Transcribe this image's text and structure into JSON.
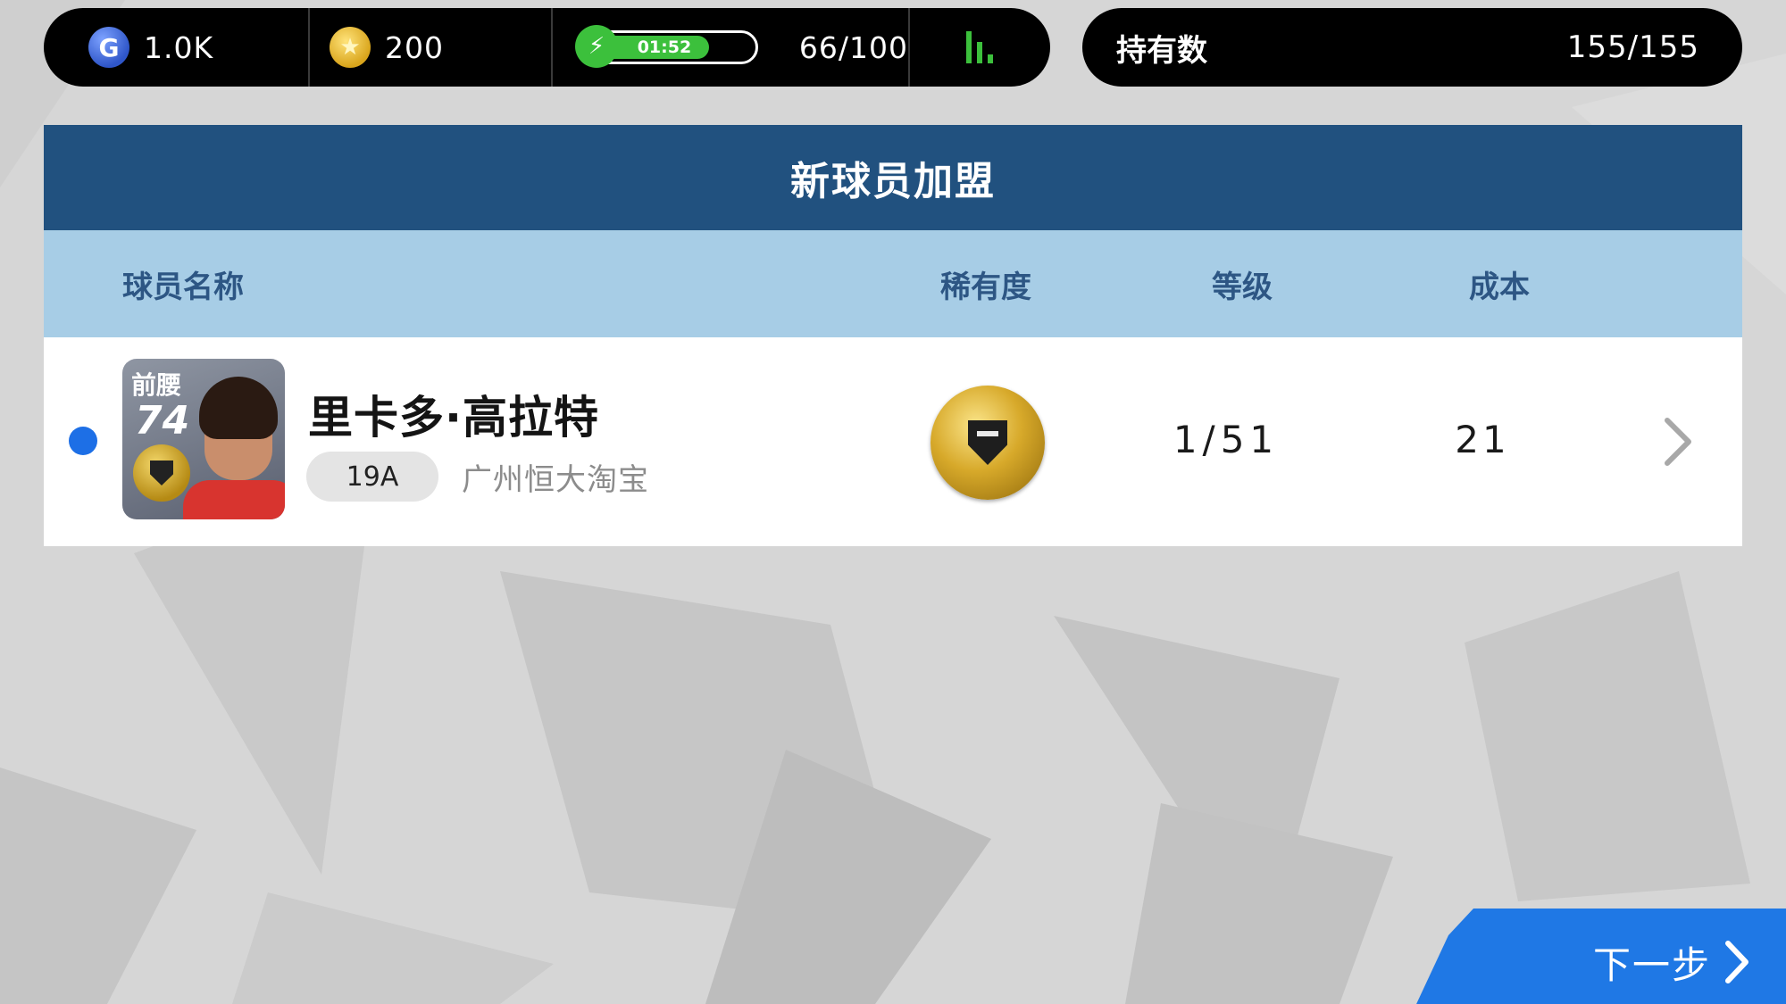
{
  "status_bar": {
    "gp_value": "1.0K",
    "coin_value": "200",
    "energy_timer": "01:52",
    "energy_count": "66/100",
    "energy_fill_fraction": 0.7
  },
  "owned": {
    "label": "持有数",
    "value": "155/155"
  },
  "panel": {
    "title": "新球员加盟",
    "columns": {
      "player_name": "球员名称",
      "rarity": "稀有度",
      "level": "等级",
      "cost": "成本"
    },
    "player": {
      "position": "前腰",
      "rating": "74",
      "name": "里卡多·高拉特",
      "season": "19A",
      "club": "广州恒大淘宝",
      "level": "1/51",
      "cost": "21"
    }
  },
  "next_button": {
    "label": "下一步"
  },
  "colors": {
    "header_blue": "#21517f",
    "column_header": "#a7cde6",
    "accent_blue": "#1f78e5",
    "energy_green": "#3cc03c"
  },
  "icons": [
    "gp-icon",
    "coin-icon",
    "energy-bolt-icon",
    "stats-icon",
    "selection-dot",
    "rarity-gold-ball-icon",
    "chevron-right-icon"
  ]
}
